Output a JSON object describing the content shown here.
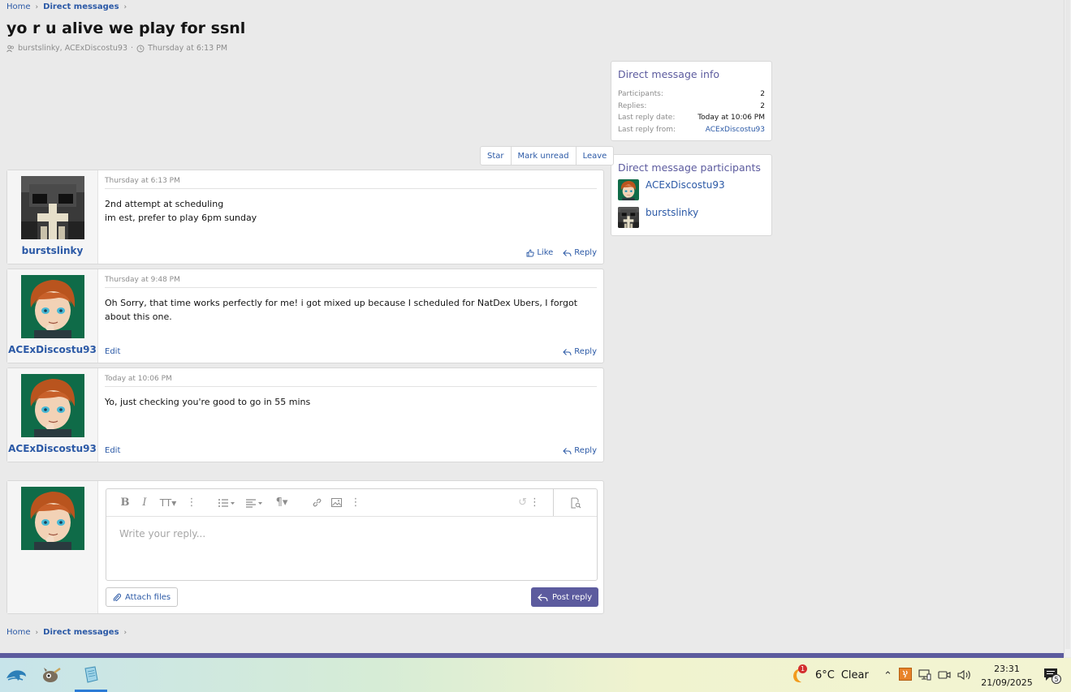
{
  "breadcrumb": {
    "home": "Home",
    "section": "Direct messages"
  },
  "conversation": {
    "title": "yo r u alive we play for ssnl",
    "participants_line": "burstslinky, ACExDiscostu93",
    "date": "Thursday at 6:13 PM"
  },
  "actions": {
    "star": "Star",
    "mark_unread": "Mark unread",
    "leave": "Leave"
  },
  "info": {
    "title": "Direct message info",
    "rows": [
      {
        "k": "Participants:",
        "v": "2"
      },
      {
        "k": "Replies:",
        "v": "2"
      },
      {
        "k": "Last reply date:",
        "v": "Today at 10:06 PM"
      },
      {
        "k": "Last reply from:",
        "v": "ACExDiscostu93"
      }
    ]
  },
  "participants": {
    "title": "Direct message participants",
    "items": [
      {
        "name": "ACExDiscostu93"
      },
      {
        "name": "burstslinky"
      }
    ]
  },
  "messages": [
    {
      "user": "burstslinky",
      "date": "Thursday at 6:13 PM",
      "lines": [
        "2nd attempt at scheduling",
        "im est, prefer to play 6pm sunday"
      ],
      "like": "Like",
      "reply": "Reply"
    },
    {
      "user": "ACExDiscostu93",
      "date": "Thursday at 9:48 PM",
      "lines": [
        "Oh Sorry, that time works perfectly for me! i got mixed up because I scheduled for NatDex Ubers, I forgot about this one."
      ],
      "edit": "Edit",
      "reply": "Reply"
    },
    {
      "user": "ACExDiscostu93",
      "date": "Today at 10:06 PM",
      "lines": [
        "Yo, just checking you're good to go in 55 mins"
      ],
      "edit": "Edit",
      "reply": "Reply"
    }
  ],
  "reply_box": {
    "placeholder": "Write your reply...",
    "attach": "Attach files",
    "post": "Post reply"
  },
  "taskbar": {
    "weather_badge": "1",
    "temp": "6°C",
    "condition": "Clear",
    "time": "23:31",
    "date": "21/09/2025",
    "notif_count": "5"
  },
  "colors": {
    "accent": "#5c5b9e",
    "link": "#2b59a6"
  }
}
